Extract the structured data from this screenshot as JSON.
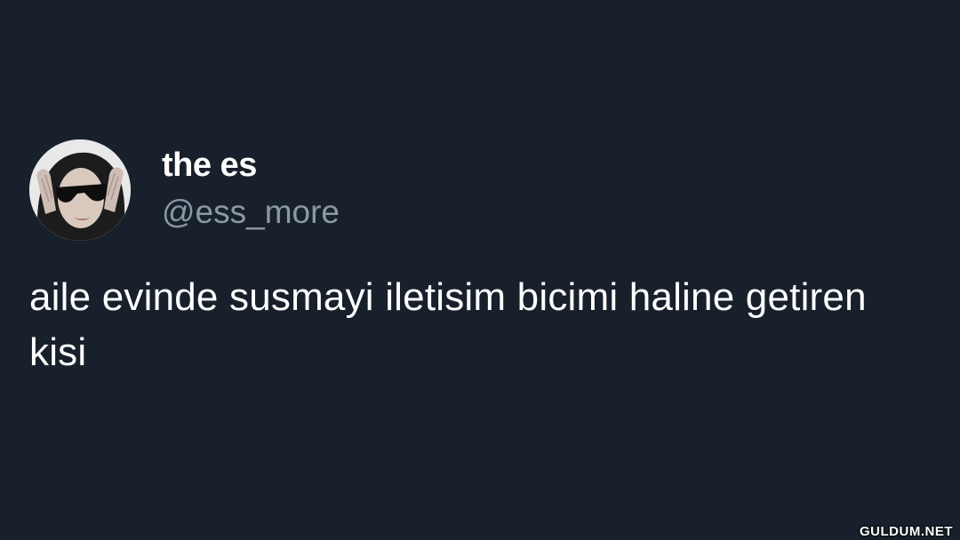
{
  "tweet": {
    "display_name": "the es",
    "handle": "@ess_more",
    "text": "aile evinde susmayi iletisim bicimi haline getiren kisi"
  },
  "avatar": {
    "description_icon": "profile-photo-woman-sunglasses"
  },
  "watermark": {
    "text": "GULDUM.NET"
  },
  "colors": {
    "background": "#17202b",
    "primary_text": "#ffffff",
    "secondary_text": "#8b98a5"
  }
}
